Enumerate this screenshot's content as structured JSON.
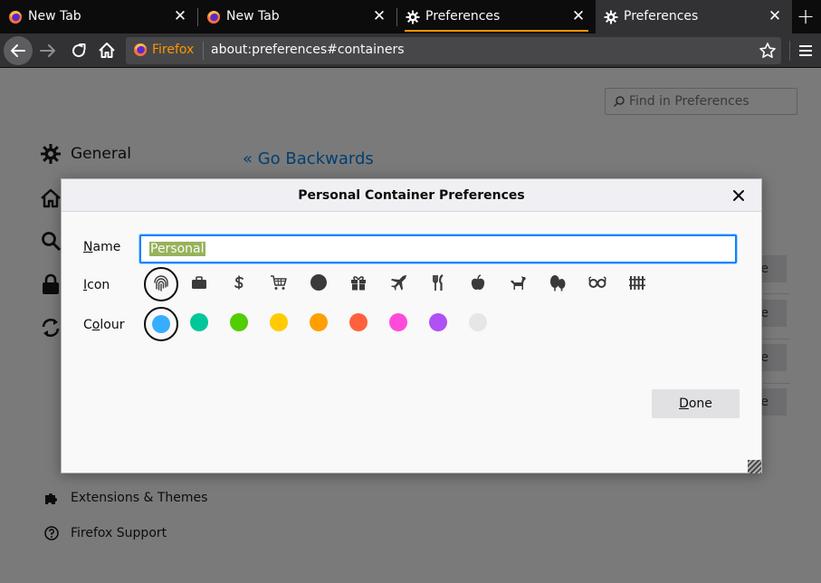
{
  "tabs": [
    {
      "label": "New Tab",
      "icon": "firefox-icon",
      "close": "✕"
    },
    {
      "label": "New Tab",
      "icon": "firefox-icon",
      "close": "✕"
    },
    {
      "label": "Preferences",
      "icon": "gear-icon",
      "close": "✕"
    },
    {
      "label": "Preferences",
      "icon": "gear-icon",
      "close": "✕",
      "active": true
    }
  ],
  "new_tab_glyph": "+",
  "urlbar": {
    "brand": "Firefox",
    "url": "about:preferences#containers"
  },
  "page": {
    "find_placeholder": "Find in Preferences",
    "categories": [
      {
        "label": "General",
        "icon": "gear-icon"
      },
      {
        "label": "",
        "icon": "home-icon"
      },
      {
        "label": "",
        "icon": "search-icon"
      },
      {
        "label": "",
        "icon": "lock-icon"
      },
      {
        "label": "",
        "icon": "sync-icon"
      }
    ],
    "go_back": "« Go Backwards",
    "bg_button_fragment": "e",
    "footer": [
      {
        "label": "Extensions & Themes",
        "icon": "puzzle-icon"
      },
      {
        "label": "Firefox Support",
        "icon": "help-icon"
      }
    ]
  },
  "dialog": {
    "title": "Personal Container Preferences",
    "name_label": "Name",
    "name_accesskey": "N",
    "name_value": "Personal",
    "icon_label": "Icon",
    "icon_accesskey": "I",
    "colour_label": "Colour",
    "colour_accesskey": "o",
    "icons": [
      "fingerprint-icon",
      "briefcase-icon",
      "dollar-icon",
      "cart-icon",
      "circle-icon",
      "gift-icon",
      "vacation-icon",
      "food-icon",
      "fruit-icon",
      "pet-icon",
      "tree-icon",
      "chill-icon",
      "fence-icon"
    ],
    "selected_icon": "fingerprint-icon",
    "colours": [
      {
        "name": "blue",
        "hex": "#37adff"
      },
      {
        "name": "turquoise",
        "hex": "#00c79a"
      },
      {
        "name": "green",
        "hex": "#51cd00"
      },
      {
        "name": "yellow",
        "hex": "#ffcb00"
      },
      {
        "name": "orange",
        "hex": "#ff9f00"
      },
      {
        "name": "red",
        "hex": "#ff613d"
      },
      {
        "name": "pink",
        "hex": "#ff4bda"
      },
      {
        "name": "purple",
        "hex": "#af51f5"
      },
      {
        "name": "toolbar",
        "hex": "#e6e6e8"
      }
    ],
    "selected_colour": "blue",
    "done_label": "Done",
    "done_accesskey": "D"
  }
}
